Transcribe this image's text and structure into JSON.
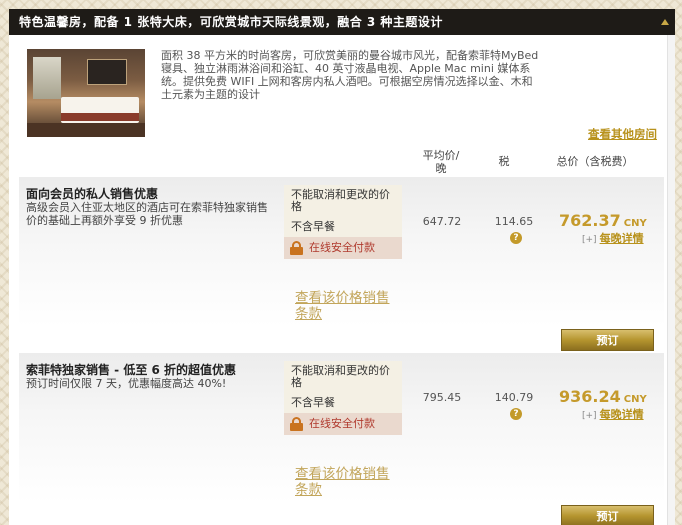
{
  "header": {
    "title": "特色温馨房，配备 1 张特大床，可欣赏城市天际线景观，融合 3 种主题设计"
  },
  "room": {
    "description": "面积 38 平方米的时尚客房，可欣赏美丽的曼谷城市风光，配备索菲特MyBed 寝具、独立淋雨淋浴间和浴缸、40 英寸液晶电视、Apple Mac mini 媒体系统。提供免费 WIFI 上网和客房内私人酒吧。可根据空房情况选择以金、木和土元素为主题的设计",
    "other_rooms_link": "查看其他房间"
  },
  "columns": {
    "avg": "平均价/晚",
    "tax": "税",
    "total": "总价（含税费）"
  },
  "rates": [
    {
      "title": "面向会员的私人销售优惠",
      "subtitle": "高级会员入住亚太地区的酒店可在索菲特独家销售价的基础上再额外享受 9 折优惠",
      "cancel_policy": "不能取消和更改的价格",
      "breakfast": "不含早餐",
      "secure_pay": "在线安全付款",
      "terms_link": "查看该价格销售条款",
      "avg_price": "647.72",
      "tax": "114.65",
      "tax_help": "?",
      "total": "762.37",
      "currency": "CNY",
      "nightly_plus": "[+]",
      "nightly_link": "每晚详情",
      "book_label": "预订"
    },
    {
      "title": "索菲特独家销售 - 低至 6 折的超值优惠",
      "subtitle": "预订时间仅限 7 天，优惠幅度高达 40%!",
      "cancel_policy": "不能取消和更改的价格",
      "breakfast": "不含早餐",
      "secure_pay": "在线安全付款",
      "terms_link": "查看该价格销售条款",
      "avg_price": "795.45",
      "tax": "140.79",
      "tax_help": "?",
      "total": "936.24",
      "currency": "CNY",
      "nightly_plus": "[+]",
      "nightly_link": "每晚详情",
      "book_label": "预订"
    }
  ],
  "colors": {
    "header_bg": "#1e1b17",
    "gold": "#c59a2b",
    "link": "#b8921c",
    "secure_text": "#b03a2e"
  }
}
